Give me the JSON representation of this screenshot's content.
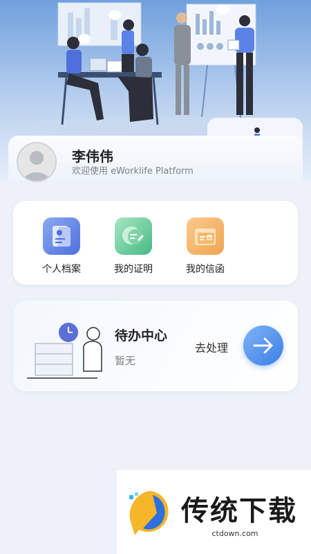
{
  "user": {
    "name": "李伟伟",
    "welcome": "欢迎使用 eWorklife Platform"
  },
  "menu": {
    "items": [
      {
        "label": "个人档案",
        "icon": "profile-folder-icon",
        "color": "#4f6fdc"
      },
      {
        "label": "我的证明",
        "icon": "certificate-edit-icon",
        "color": "#46b982"
      },
      {
        "label": "我的信函",
        "icon": "letter-envelope-icon",
        "color": "#f0a552"
      }
    ]
  },
  "todo": {
    "title": "待办中心",
    "subtitle": "暂无",
    "action": "去处理"
  },
  "watermark": {
    "brand": "传统下载",
    "url": "ctdown.com"
  },
  "colors": {
    "accent": "#3a7ee6",
    "background": "#eef2f8"
  }
}
